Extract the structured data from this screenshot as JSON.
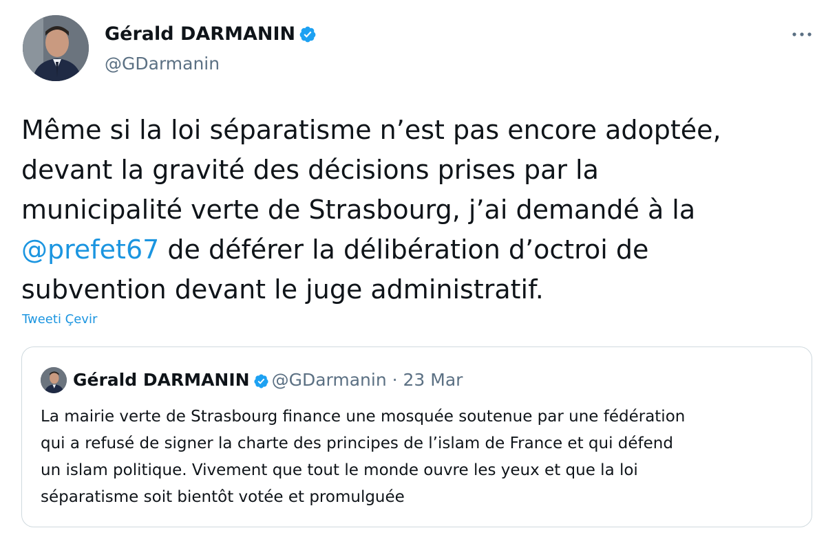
{
  "author": {
    "name": "Gérald DARMANIN",
    "handle": "@GDarmanin",
    "verified": true
  },
  "more_icon": "more-horizontal-icon",
  "tweet": {
    "line1": "Même si la loi séparatisme n’est pas encore adoptée,",
    "line2": "devant la gravité des décisions prises par la",
    "line3": "municipalité verte de Strasbourg, j’ai demandé à la",
    "mention": "@prefet67",
    "line4_rest": " de déférer la délibération d’octroi de",
    "line5": "subvention devant le juge administratif."
  },
  "translate_label": "Tweeti Çevir",
  "quoted": {
    "name": "Gérald DARMANIN",
    "meta": "@GDarmanin · 23 Mar",
    "line1": "La mairie verte de Strasbourg finance une mosquée soutenue par une fédération",
    "line2": "qui a refusé de signer la charte des principes de l’islam de France et qui défend",
    "line3": "un islam politique. Vivement que tout le monde ouvre les yeux et que la loi",
    "line4": "séparatisme soit bientôt votée et promulguée"
  },
  "colors": {
    "link": "#1b95e0",
    "verified": "#1da1f2",
    "secondary_text": "#5b7083",
    "border": "#cfd9de"
  }
}
